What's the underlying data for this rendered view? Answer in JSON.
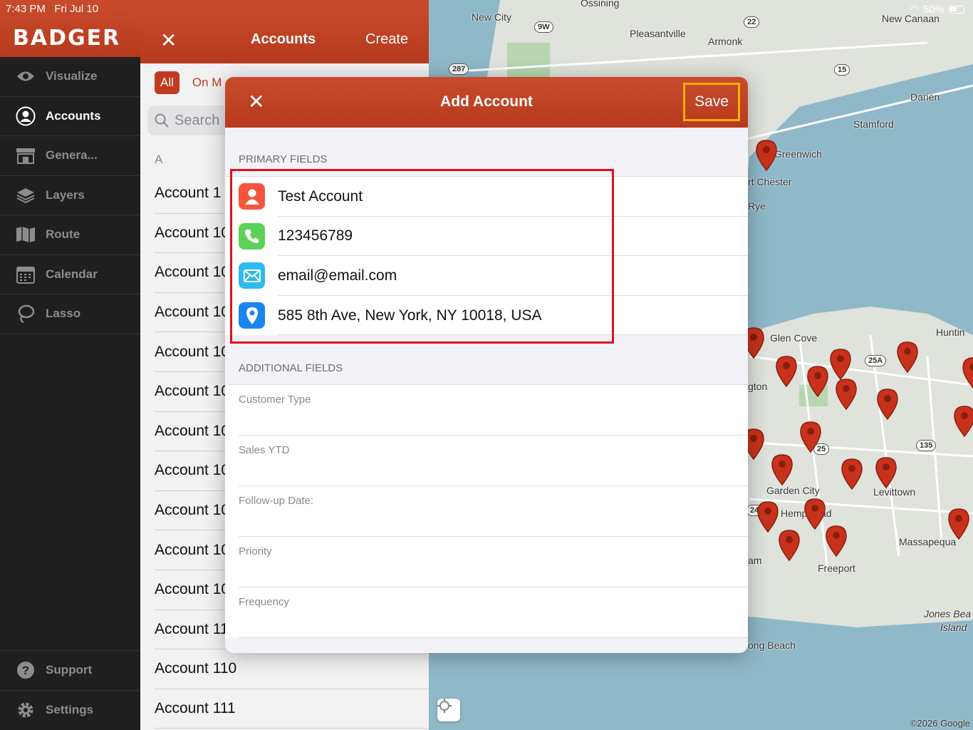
{
  "status_bar": {
    "time": "7:43 PM",
    "date": "Fri Jul 10",
    "battery": "50%"
  },
  "sidebar": {
    "brand": "BADGER",
    "items": [
      {
        "label": "Visualize",
        "icon": "eye-icon"
      },
      {
        "label": "Accounts",
        "icon": "person-circle-icon"
      },
      {
        "label": "Genera...",
        "icon": "storefront-icon"
      },
      {
        "label": "Layers",
        "icon": "layers-icon"
      },
      {
        "label": "Route",
        "icon": "map-icon"
      },
      {
        "label": "Calendar",
        "icon": "calendar-icon"
      },
      {
        "label": "Lasso",
        "icon": "lasso-icon"
      }
    ],
    "bottom_items": [
      {
        "label": "Support",
        "icon": "question-icon"
      },
      {
        "label": "Settings",
        "icon": "gear-icon"
      }
    ]
  },
  "accounts_panel": {
    "title": "Accounts",
    "create_label": "Create",
    "close_glyph": "✕",
    "filter_all": "All",
    "filter_on": "On M",
    "search_placeholder": "Search",
    "section_letter": "A",
    "rows": [
      "Account 1",
      "Account 10",
      "Account 10",
      "Account 10",
      "Account 10",
      "Account 10",
      "Account 10",
      "Account 10",
      "Account 10",
      "Account 10",
      "Account 10",
      "Account 11",
      "Account 110",
      "Account 111"
    ]
  },
  "modal": {
    "title": "Add Account",
    "save_label": "Save",
    "close_glyph": "✕",
    "primary_label": "PRIMARY FIELDS",
    "primary_fields": [
      {
        "value": "Test Account",
        "icon": "person-icon",
        "color": "#f5553d"
      },
      {
        "value": "123456789",
        "icon": "phone-icon",
        "color": "#5cd25a"
      },
      {
        "value": "email@email.com",
        "icon": "envelope-icon",
        "color": "#2fbaf0"
      },
      {
        "value": "585 8th Ave, New York, NY 10018, USA",
        "icon": "location-pin-icon",
        "color": "#1a84f0"
      }
    ],
    "additional_label": "ADDITIONAL FIELDS",
    "additional_fields": [
      "Customer Type",
      "Sales YTD",
      "Follow-up Date:",
      "Priority",
      "Frequency"
    ]
  },
  "map": {
    "labels": [
      "Ossining",
      "New City",
      "Pleasantville",
      "Armonk",
      "New Canaan",
      "Darien",
      "Stamford",
      "Greenwich",
      "rt Chester",
      "Rye",
      "Glen Cove",
      "Huntin",
      "gton",
      "Garden City",
      "Levittown",
      "Hempstead",
      "Massapequa",
      "Freeport",
      "Jones Bea",
      "Island",
      "ong Beach",
      "am"
    ],
    "shields": [
      "9W",
      "22",
      "287",
      "15",
      "25A",
      "25",
      "135",
      "24"
    ],
    "copyright": "©2026 Google"
  }
}
